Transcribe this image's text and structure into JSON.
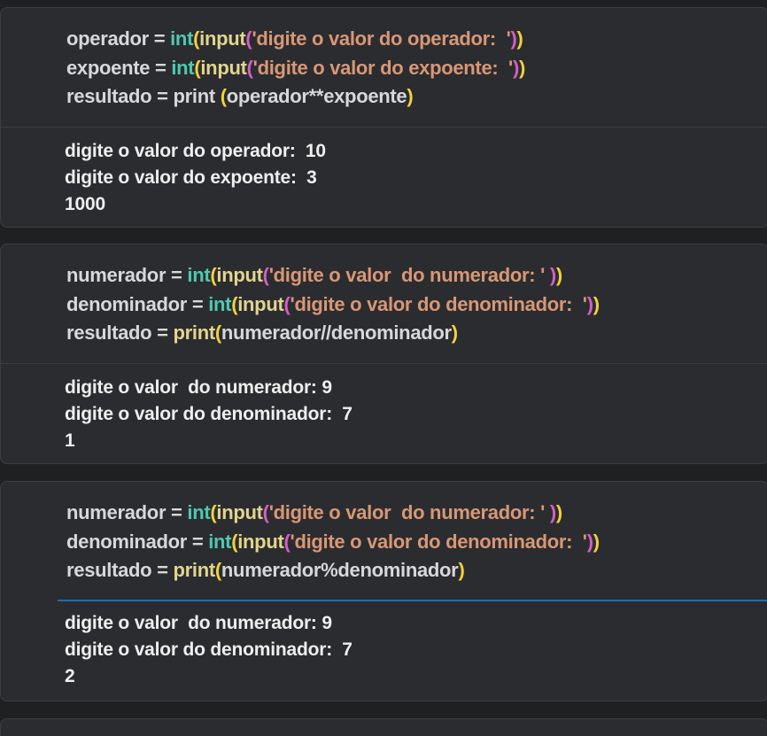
{
  "cells": [
    {
      "code": [
        [
          {
            "t": "operador = ",
            "c": ""
          },
          {
            "t": "int",
            "c": "fn"
          },
          {
            "t": "(",
            "c": "p1"
          },
          {
            "t": "input",
            "c": "call"
          },
          {
            "t": "(",
            "c": "p2"
          },
          {
            "t": "'digite o valor do operador:  '",
            "c": "str"
          },
          {
            "t": ")",
            "c": "p2"
          },
          {
            "t": ")",
            "c": "p1"
          }
        ],
        [
          {
            "t": "expoente = ",
            "c": ""
          },
          {
            "t": "int",
            "c": "fn"
          },
          {
            "t": "(",
            "c": "p1"
          },
          {
            "t": "input",
            "c": "call"
          },
          {
            "t": "(",
            "c": "p2"
          },
          {
            "t": "'digite o valor do expoente:  '",
            "c": "str"
          },
          {
            "t": ")",
            "c": "p2"
          },
          {
            "t": ")",
            "c": "p1"
          }
        ],
        [
          {
            "t": "resultado = print ",
            "c": ""
          },
          {
            "t": "(",
            "c": "p1"
          },
          {
            "t": "operador**expoente",
            "c": ""
          },
          {
            "t": ")",
            "c": "p1"
          }
        ]
      ],
      "output": [
        "digite o valor do operador:  10",
        "digite o valor do expoente:  3",
        "1000"
      ]
    },
    {
      "code": [
        [
          {
            "t": "numerador = ",
            "c": ""
          },
          {
            "t": "int",
            "c": "fn"
          },
          {
            "t": "(",
            "c": "p1"
          },
          {
            "t": "input",
            "c": "call"
          },
          {
            "t": "(",
            "c": "p2"
          },
          {
            "t": "'digite o valor  do numerador: ' ",
            "c": "str"
          },
          {
            "t": ")",
            "c": "p2"
          },
          {
            "t": ")",
            "c": "p1"
          }
        ],
        [
          {
            "t": "denominador = ",
            "c": ""
          },
          {
            "t": "int",
            "c": "fn"
          },
          {
            "t": "(",
            "c": "p1"
          },
          {
            "t": "input",
            "c": "call"
          },
          {
            "t": "(",
            "c": "p2"
          },
          {
            "t": "'digite o valor do denominador:  '",
            "c": "str"
          },
          {
            "t": ")",
            "c": "p2"
          },
          {
            "t": ")",
            "c": "p1"
          }
        ],
        [
          {
            "t": "resultado = ",
            "c": ""
          },
          {
            "t": "print",
            "c": "call"
          },
          {
            "t": "(",
            "c": "p1"
          },
          {
            "t": "numerador//denominador",
            "c": ""
          },
          {
            "t": ")",
            "c": "p1"
          }
        ]
      ],
      "output": [
        "digite o valor  do numerador: 9",
        "digite o valor do denominador:  7",
        "1"
      ]
    },
    {
      "code": [
        [
          {
            "t": "numerador = ",
            "c": ""
          },
          {
            "t": "int",
            "c": "fn"
          },
          {
            "t": "(",
            "c": "p1"
          },
          {
            "t": "input",
            "c": "call"
          },
          {
            "t": "(",
            "c": "p2"
          },
          {
            "t": "'digite o valor  do numerador: ' ",
            "c": "str"
          },
          {
            "t": ")",
            "c": "p2"
          },
          {
            "t": ")",
            "c": "p1"
          }
        ],
        [
          {
            "t": "denominador = ",
            "c": ""
          },
          {
            "t": "int",
            "c": "fn"
          },
          {
            "t": "(",
            "c": "p1"
          },
          {
            "t": "input",
            "c": "call"
          },
          {
            "t": "(",
            "c": "p2"
          },
          {
            "t": "'digite o valor do denominador:  '",
            "c": "str"
          },
          {
            "t": ")",
            "c": "p2"
          },
          {
            "t": ")",
            "c": "p1"
          }
        ],
        [
          {
            "t": "resultado = ",
            "c": ""
          },
          {
            "t": "print",
            "c": "call"
          },
          {
            "t": "(",
            "c": "p1"
          },
          {
            "t": "numerador%denominador",
            "c": ""
          },
          {
            "t": ")",
            "c": "p1"
          }
        ]
      ],
      "output": [
        "digite o valor  do numerador: 9",
        "digite o valor do denominador:  7",
        "2"
      ]
    }
  ],
  "colors": {
    "builtin_int": "#4ec9b0",
    "function_call": "#e2d58e",
    "string": "#d89776",
    "bracket_outer": "#f3d13e",
    "bracket_inner": "#d35fc7",
    "active_divider": "#1f6fae"
  }
}
